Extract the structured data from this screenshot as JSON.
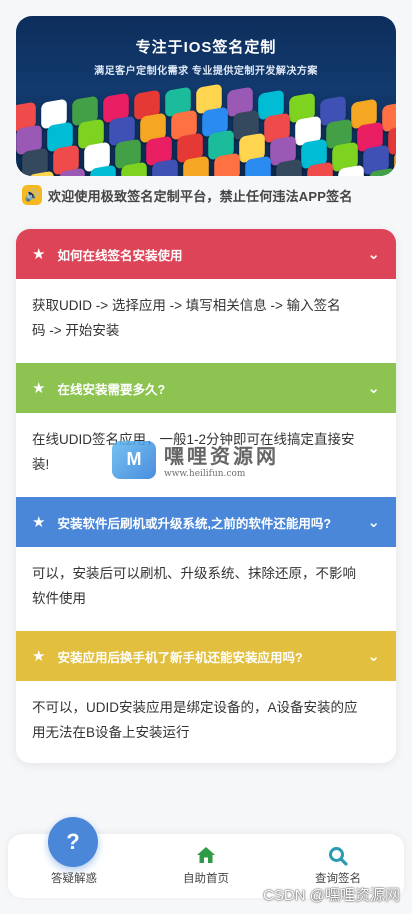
{
  "banner": {
    "title": "专注于IOS签名定制",
    "subtitle": "满足客户定制化需求 专业提供定制开发解决方案"
  },
  "notice": {
    "icon": "speaker-icon",
    "text": "欢迎使用极致签名定制平台，禁止任何违法APP签名"
  },
  "faq": [
    {
      "color": "#de4457",
      "question": "如何在线签名安装使用",
      "answer_lines": [
        "获取UDID -> 选择应用 -> 填写相关信息 -> 输入签名",
        "码 -> 开始安装"
      ]
    },
    {
      "color": "#8cc351",
      "question": "在线安装需要多久?",
      "answer_lines": [
        "在线UDID签名应用，一般1-2分钟即可在线搞定直接安",
        "装!"
      ]
    },
    {
      "color": "#4a87d8",
      "question": "安装软件后刷机或升级系统,之前的软件还能用吗?",
      "answer_lines": [
        "可以，安装后可以刷机、升级系统、抹除还原，不影响",
        "软件使用"
      ]
    },
    {
      "color": "#e2bf3f",
      "question": "安装应用后换手机了新手机还能安装应用吗?",
      "answer_lines": [
        "不可以，UDID安装应用是绑定设备的，A设备安装的应",
        "用无法在B设备上安装运行"
      ]
    }
  ],
  "watermark": {
    "title": "嘿哩资源网",
    "url": "www.heilifun.com"
  },
  "tabbar": {
    "items": [
      {
        "label": "答疑解惑",
        "icon": "question-icon",
        "color": "#4a87d8"
      },
      {
        "label": "自助首页",
        "icon": "home-icon",
        "color": "#2e9a45"
      },
      {
        "label": "查询签名",
        "icon": "search-icon",
        "color": "#2a9bb0"
      }
    ]
  },
  "credit": "CSDN @嘿哩资源网"
}
